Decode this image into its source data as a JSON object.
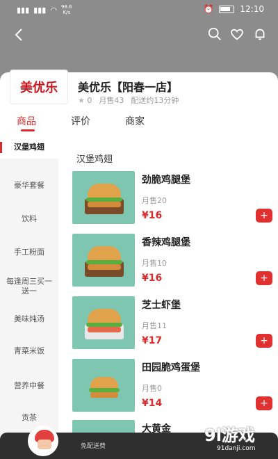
{
  "status_bar": {
    "signal_1": "4G",
    "signal_2": "4G",
    "network_speed_value": "98.6",
    "network_speed_unit": "K/s",
    "time": "12:10"
  },
  "colors": {
    "accent": "#d92d2d",
    "header_gray": "#8c8c8c",
    "sidebar_bg": "#f5f5f5"
  },
  "shop": {
    "logo_text": "美优乐",
    "name": "美优乐【阳春一店】",
    "rating": "0",
    "monthly_sales": "月售43",
    "delivery_time": "配送约13分钟"
  },
  "tabs": [
    {
      "label": "商品"
    },
    {
      "label": "评价"
    },
    {
      "label": "商家"
    }
  ],
  "categories": [
    {
      "label": "汉堡鸡翅"
    },
    {
      "label": "豪华套餐"
    },
    {
      "label": "饮料"
    },
    {
      "label": "手工粉面"
    },
    {
      "label": "每逢周三买一送一"
    },
    {
      "label": "美味炖汤"
    },
    {
      "label": "青菜米饭"
    },
    {
      "label": "营养中餐"
    },
    {
      "label": "贡茶"
    }
  ],
  "section_title": "汉堡鸡翅",
  "products": [
    {
      "name": "劲脆鸡腿堡",
      "sales": "月售20",
      "price": "¥16"
    },
    {
      "name": "香辣鸡腿堡",
      "sales": "月售10",
      "price": "¥16"
    },
    {
      "name": "芝士虾堡",
      "sales": "月售11",
      "price": "¥17"
    },
    {
      "name": "田园脆鸡蛋堡",
      "sales": "月售0",
      "price": "¥14"
    },
    {
      "name": "大黄金",
      "sales": "",
      "price": ""
    }
  ],
  "cart": {
    "delivery_label": "免配送费"
  },
  "watermark": {
    "text": "9l游戏",
    "url": "91danji.com"
  }
}
